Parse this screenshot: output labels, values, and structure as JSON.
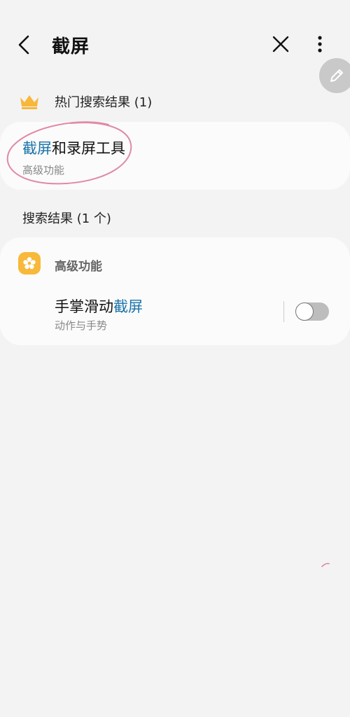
{
  "header": {
    "title": "截屏"
  },
  "popular": {
    "heading": "热门搜索结果 (1)",
    "result": {
      "highlight": "截屏",
      "rest": "和录屏工具",
      "subtitle": "高级功能"
    }
  },
  "results": {
    "heading": "搜索结果 (1 个)",
    "category": "高级功能",
    "item": {
      "prefix": "手掌滑动",
      "highlight": "截屏",
      "subtitle": "动作与手势",
      "toggle_on": false
    }
  },
  "colors": {
    "highlight": "#1a73a8",
    "crown": "#f7b73b",
    "category_icon_bg": "#f8b83a",
    "annotation": "#e08aa6"
  },
  "icons": {
    "back": "back-arrow-icon",
    "close": "close-icon",
    "more": "more-vertical-icon",
    "edit": "pencil-icon",
    "crown": "crown-icon",
    "category": "gear-icon"
  }
}
